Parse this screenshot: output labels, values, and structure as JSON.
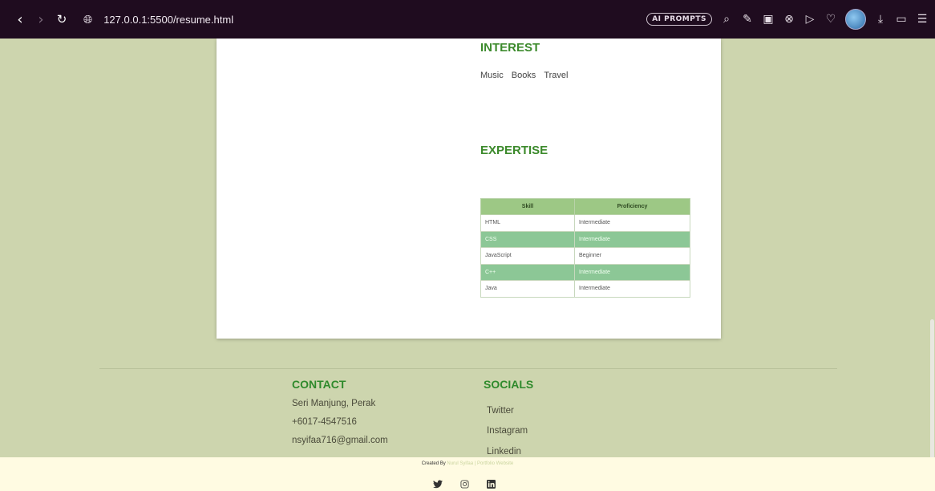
{
  "browser": {
    "url": "127.0.0.1:5500/resume.html",
    "ai_prompts_label": "AI PROMPTS",
    "icons": [
      "back-icon",
      "forward-icon",
      "reload-icon",
      "site-info-icon",
      "search-icon",
      "edit-icon",
      "camera-icon",
      "close-circle-icon",
      "send-icon",
      "heart-icon",
      "download-icon",
      "battery-icon",
      "menu-icon"
    ]
  },
  "interest": {
    "title": "INTEREST",
    "items": [
      "Music",
      "Books",
      "Travel"
    ]
  },
  "expertise": {
    "title": "EXPERTISE",
    "headers": [
      "Skill",
      "Proficiency"
    ],
    "rows": [
      [
        "HTML",
        "Intermediate"
      ],
      [
        "CSS",
        "Intermediate"
      ],
      [
        "JavaScript",
        "Beginner"
      ],
      [
        "C++",
        "Intermediate"
      ],
      [
        "Java",
        "Intermediate"
      ]
    ]
  },
  "contact": {
    "title": "CONTACT",
    "location": "Seri Manjung, Perak",
    "phone": "+6017-4547516",
    "email": "nsyifaa716@gmail.com"
  },
  "socials": {
    "title": "SOCIALS",
    "links": [
      "Twitter",
      "Instagram",
      "Linkedin"
    ]
  },
  "footer": {
    "credit_prefix": "Created By",
    "credit_name": "Nurul Syifaa | Portfolio Website",
    "icons": [
      "twitter-icon",
      "instagram-icon",
      "linkedin-icon"
    ]
  },
  "colors": {
    "page_bg": "#cdd5ae",
    "accent_green": "#3c8a2c",
    "table_header": "#9dc885",
    "table_alt_row": "#8cc796",
    "bottom_bar": "#fffbe2"
  }
}
